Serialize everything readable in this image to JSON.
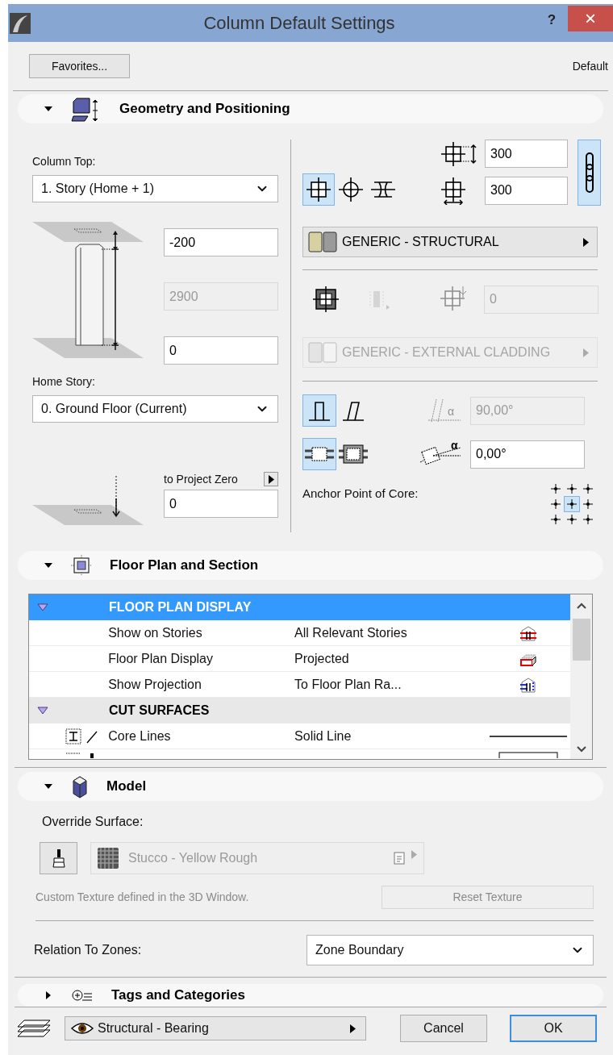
{
  "window": {
    "title": "Column Default Settings",
    "help": "?",
    "close": "×"
  },
  "toolbar": {
    "favorites": "Favorites...",
    "default_label": "Default"
  },
  "geometry": {
    "header": {
      "title": "Geometry and Positioning",
      "expanded": true
    },
    "column_top": {
      "label": "Column Top:",
      "value": "1. Story (Home + 1)"
    },
    "top_offset": {
      "value": "-200",
      "disabled": false
    },
    "height": {
      "value": "2900",
      "disabled": true
    },
    "bottom_offset": {
      "value": "0",
      "disabled": false
    },
    "home_story": {
      "label": "Home Story:",
      "value": "0. Ground Floor (Current)"
    },
    "project_zero": {
      "label": "to Project Zero",
      "value": "0",
      "disabled": false
    },
    "width": {
      "value": "300",
      "disabled": false
    },
    "depth": {
      "value": "300",
      "disabled": false
    },
    "link": {
      "selected": true
    },
    "shape_buttons": [
      {
        "kind": "rectangular",
        "selected": true
      },
      {
        "kind": "circular",
        "selected": false
      },
      {
        "kind": "profile",
        "selected": false
      }
    ],
    "building_material": {
      "value": "GENERIC - STRUCTURAL",
      "disabled": false
    },
    "veneer_buttons": [
      {
        "kind": "veneer",
        "selected": false,
        "disabled": false
      },
      {
        "kind": "veneer-type",
        "selected": false,
        "disabled": true
      }
    ],
    "veneer_thickness": {
      "value": "0",
      "disabled": true
    },
    "veneer_material": {
      "value": "GENERIC - EXTERNAL CLADDING",
      "disabled": true
    },
    "slant_buttons": [
      {
        "kind": "vertical",
        "selected": true
      },
      {
        "kind": "slanted",
        "selected": false
      }
    ],
    "slant_angle": {
      "symbol": "α",
      "value": "90,00°",
      "disabled": true
    },
    "wrap_buttons": [
      {
        "kind": "unwrapped",
        "selected": true
      },
      {
        "kind": "wrapped",
        "selected": false
      }
    ],
    "rotation_angle": {
      "symbol": "α",
      "value": "0,00°",
      "disabled": false
    },
    "anchor": {
      "label": "Anchor Point of Core:",
      "points": [
        {
          "selected": false
        },
        {
          "selected": false
        },
        {
          "selected": false
        },
        {
          "selected": false
        },
        {
          "selected": true
        },
        {
          "selected": false
        },
        {
          "selected": false
        },
        {
          "selected": false
        },
        {
          "selected": false
        }
      ]
    }
  },
  "floor_plan": {
    "header": {
      "title": "Floor Plan and Section",
      "expanded": true
    },
    "tree": [
      {
        "title": "FLOOR PLAN DISPLAY",
        "expanded": true,
        "selected": true,
        "children": [
          {
            "kind": "stories",
            "name": "Show on Stories",
            "value": "All Relevant Stories"
          },
          {
            "kind": "display",
            "name": "Floor Plan Display",
            "value": "Projected"
          },
          {
            "kind": "projection",
            "name": "Show Projection",
            "value": "To Floor Plan Ra..."
          }
        ]
      },
      {
        "title": "CUT SURFACES",
        "expanded": true,
        "selected": false,
        "children": [
          {
            "kind": "line",
            "name": "Core Lines",
            "value": "Solid Line"
          },
          {
            "kind": "fill"
          }
        ]
      }
    ]
  },
  "model": {
    "header": {
      "title": "Model",
      "expanded": true
    },
    "override_label": "Override Surface:",
    "surface": {
      "value": "Stucco - Yellow Rough",
      "disabled": true
    },
    "note": "Custom Texture defined in the 3D Window.",
    "reset_button": {
      "label": "Reset Texture",
      "disabled": true
    },
    "zones": {
      "label": "Relation To Zones:",
      "value": "Zone Boundary"
    }
  },
  "tags": {
    "header": {
      "title": "Tags and Categories",
      "expanded": false
    }
  },
  "footer": {
    "structural_function": "Structural - Bearing",
    "cancel": "Cancel",
    "ok": "OK"
  }
}
